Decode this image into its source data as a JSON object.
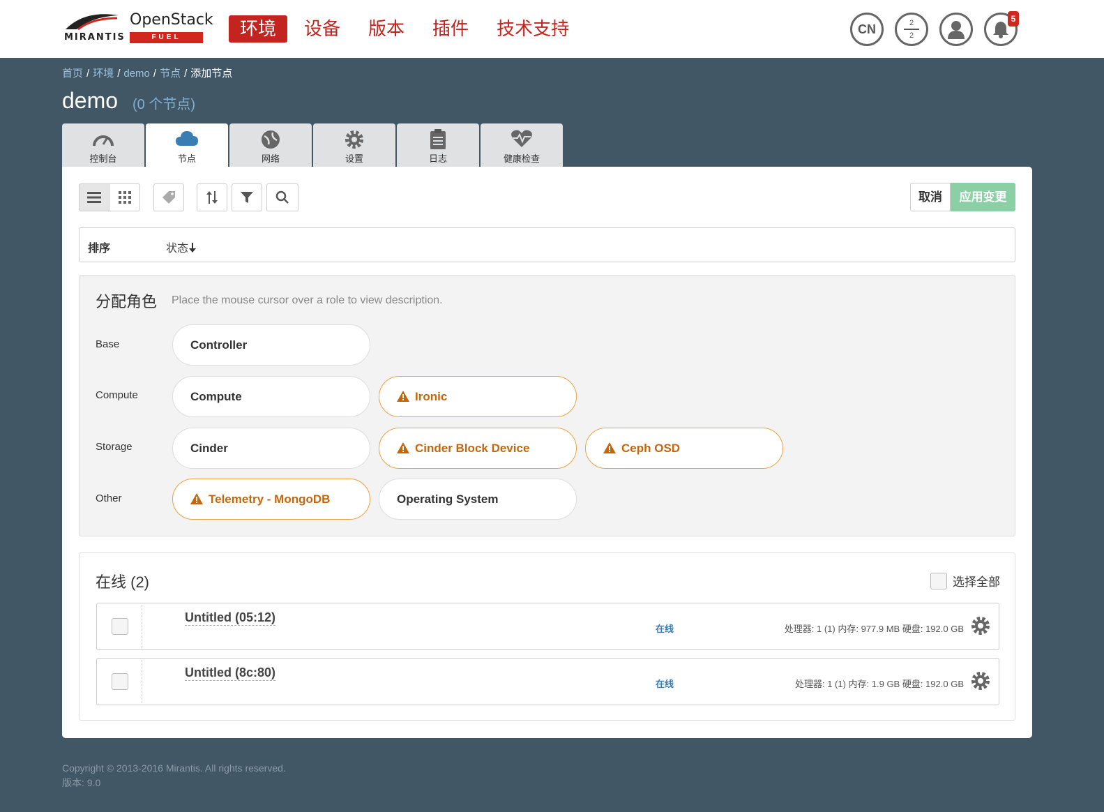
{
  "header": {
    "logo": {
      "brand": "MIRANTIS",
      "product": "OpenStack",
      "sub": "FUEL"
    },
    "nav": [
      {
        "label": "环境",
        "active": true
      },
      {
        "label": "设备",
        "active": false
      },
      {
        "label": "版本",
        "active": false
      },
      {
        "label": "插件",
        "active": false
      },
      {
        "label": "技术支持",
        "active": false
      }
    ],
    "lang": "CN",
    "nodes_fraction": {
      "top": "2",
      "bottom": "2"
    },
    "notifications_count": "5"
  },
  "breadcrumb": [
    "首页",
    "环境",
    "demo",
    "节点",
    "添加节点"
  ],
  "page": {
    "title": "demo",
    "node_count": "(0 个节点)"
  },
  "tabs": [
    {
      "label": "控制台",
      "icon": "dashboard-icon",
      "active": false
    },
    {
      "label": "节点",
      "icon": "cloud-icon",
      "active": true
    },
    {
      "label": "网络",
      "icon": "globe-icon",
      "active": false
    },
    {
      "label": "设置",
      "icon": "gear-icon",
      "active": false
    },
    {
      "label": "日志",
      "icon": "clipboard-icon",
      "active": false
    },
    {
      "label": "健康检查",
      "icon": "heart-pulse-icon",
      "active": false
    }
  ],
  "toolbar": {
    "cancel": "取消",
    "apply": "应用变更"
  },
  "sort": {
    "label": "排序",
    "status": "状态"
  },
  "roles": {
    "title": "分配角色",
    "hint": "Place the mouse cursor over a role to view description.",
    "groups": [
      {
        "name": "Base",
        "items": [
          {
            "label": "Controller",
            "warning": false
          }
        ]
      },
      {
        "name": "Compute",
        "items": [
          {
            "label": "Compute",
            "warning": false
          },
          {
            "label": "Ironic",
            "warning": true
          }
        ]
      },
      {
        "name": "Storage",
        "items": [
          {
            "label": "Cinder",
            "warning": false
          },
          {
            "label": "Cinder Block Device",
            "warning": true
          },
          {
            "label": "Ceph OSD",
            "warning": true
          }
        ]
      },
      {
        "name": "Other",
        "items": [
          {
            "label": "Telemetry - MongoDB",
            "warning": true
          },
          {
            "label": "Operating System",
            "warning": false
          }
        ]
      }
    ]
  },
  "nodes": {
    "title": "在线 (2)",
    "select_all": "选择全部",
    "items": [
      {
        "name": "Untitled (05:12)",
        "status": "在线",
        "specs": "处理器: 1 (1)  内存: 977.9 MB  硬盘: 192.0 GB"
      },
      {
        "name": "Untitled (8c:80)",
        "status": "在线",
        "specs": "处理器: 1 (1)  内存: 1.9 GB  硬盘: 192.0 GB"
      }
    ]
  },
  "footer": {
    "copyright": "Copyright © 2013-2016 Mirantis. All rights reserved.",
    "version": "版本: 9.0"
  },
  "colors": {
    "accent": "#c4241f",
    "apply_button": "#8bcfa5",
    "background": "#415766",
    "warning": "#c5660a"
  }
}
